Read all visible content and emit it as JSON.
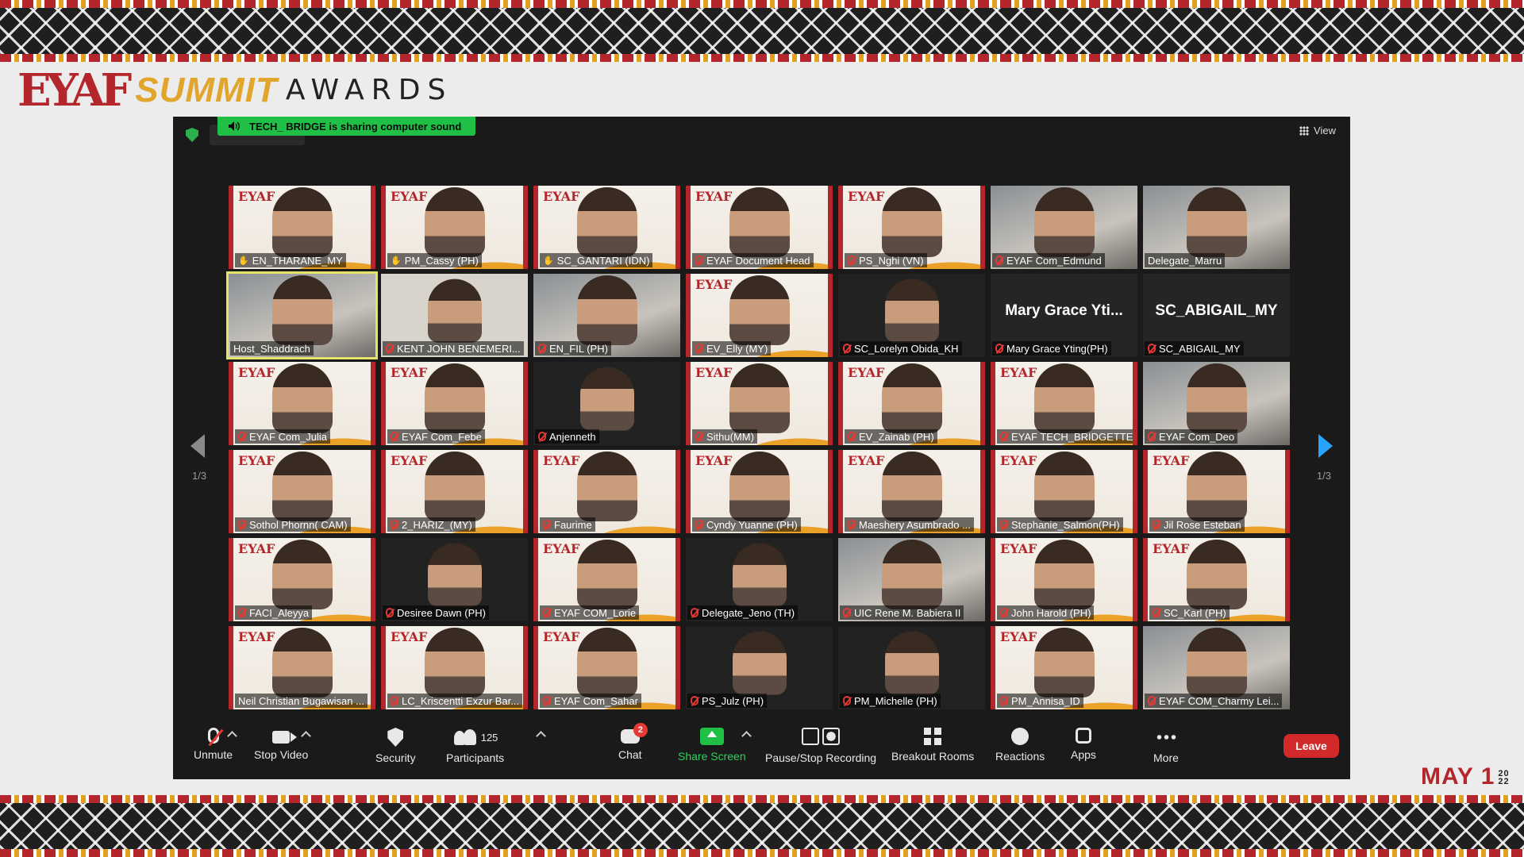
{
  "branding": {
    "logo_mark": "EYAF",
    "logo_summit": "SUMMIT",
    "logo_awards": "AWARDS",
    "date_main": "MAY 1",
    "date_year": "2022",
    "accent_color": "#b3262b",
    "gold_color": "#e2a52c"
  },
  "meeting": {
    "sharing_banner": "TECH_ BRIDGE is sharing computer sound",
    "view_label": "View",
    "page_indicator": "1/3"
  },
  "participants": [
    {
      "name": "EN_THARANE_MY",
      "bg": "banner",
      "mic": "raised"
    },
    {
      "name": "PM_Cassy (PH)",
      "bg": "banner",
      "mic": "raised"
    },
    {
      "name": "SC_GANTARI (IDN)",
      "bg": "banner",
      "mic": "raised"
    },
    {
      "name": "EYAF Document Head",
      "bg": "banner",
      "mic": "muted"
    },
    {
      "name": "PS_Nghi (VN)",
      "bg": "banner",
      "mic": "muted"
    },
    {
      "name": "EYAF Com_Edmund",
      "bg": "webcam",
      "mic": "muted"
    },
    {
      "name": "Delegate_Marru",
      "bg": "webcam",
      "mic": "none"
    },
    {
      "name": "Host_Shaddrach",
      "bg": "webcam",
      "mic": "none",
      "active": true
    },
    {
      "name": "KENT JOHN BENEMERI...",
      "bg": "plain",
      "mic": "muted"
    },
    {
      "name": "EN_FIL (PH)",
      "bg": "webcam",
      "mic": "muted"
    },
    {
      "name": "EV_Elly (MY)",
      "bg": "banner",
      "mic": "muted"
    },
    {
      "name": "SC_Lorelyn Obida_KH",
      "bg": "dark",
      "mic": "muted"
    },
    {
      "name": "Mary Grace Yting(PH)",
      "bg": "name",
      "mic": "muted",
      "big": "Mary Grace Yti..."
    },
    {
      "name": "SC_ABIGAIL_MY",
      "bg": "name",
      "mic": "muted",
      "big": "SC_ABIGAIL_MY"
    },
    {
      "name": "EYAF Com_Julia",
      "bg": "banner",
      "mic": "muted"
    },
    {
      "name": "EYAF Com_Febe",
      "bg": "banner",
      "mic": "muted"
    },
    {
      "name": "Anjenneth",
      "bg": "dark",
      "mic": "muted"
    },
    {
      "name": "Sithu(MM)",
      "bg": "banner",
      "mic": "muted"
    },
    {
      "name": "EV_Zainab (PH)",
      "bg": "banner",
      "mic": "muted"
    },
    {
      "name": "EYAF TECH_BRIDGETTE",
      "bg": "banner",
      "mic": "muted"
    },
    {
      "name": "EYAF Com_Deo",
      "bg": "webcam",
      "mic": "muted"
    },
    {
      "name": "Sothol Phornn( CAM)",
      "bg": "banner",
      "mic": "muted"
    },
    {
      "name": "2_HARIZ_(MY)",
      "bg": "banner",
      "mic": "muted"
    },
    {
      "name": "Faurime",
      "bg": "banner",
      "mic": "muted"
    },
    {
      "name": "Cyndy Yuanne (PH)",
      "bg": "banner",
      "mic": "muted"
    },
    {
      "name": "Maeshery Asumbrado ...",
      "bg": "banner",
      "mic": "muted"
    },
    {
      "name": "Stephanie_Salmon(PH)",
      "bg": "banner",
      "mic": "muted"
    },
    {
      "name": "Jil Rose Esteban",
      "bg": "banner",
      "mic": "muted"
    },
    {
      "name": "FACI_Aleyya",
      "bg": "banner",
      "mic": "muted"
    },
    {
      "name": "Desiree Dawn  (PH)",
      "bg": "dark",
      "mic": "muted"
    },
    {
      "name": "EYAF COM_Lorie",
      "bg": "banner",
      "mic": "muted"
    },
    {
      "name": "Delegate_Jeno (TH)",
      "bg": "dark",
      "mic": "muted"
    },
    {
      "name": "UIC Rene M. Babiera II",
      "bg": "webcam",
      "mic": "muted"
    },
    {
      "name": "John Harold (PH)",
      "bg": "banner",
      "mic": "muted"
    },
    {
      "name": "SC_Karl (PH)",
      "bg": "banner",
      "mic": "muted"
    },
    {
      "name": "Neil Christian Bugawisan ...",
      "bg": "banner",
      "mic": "none"
    },
    {
      "name": "LC_Kriscentti Exzur Bar...",
      "bg": "banner",
      "mic": "muted"
    },
    {
      "name": "EYAF Com_Sahar",
      "bg": "banner",
      "mic": "muted"
    },
    {
      "name": "PS_Julz (PH)",
      "bg": "dark",
      "mic": "muted"
    },
    {
      "name": "PM_Michelle (PH)",
      "bg": "dark",
      "mic": "muted"
    },
    {
      "name": "PM_Annisa_ID",
      "bg": "banner",
      "mic": "muted"
    },
    {
      "name": "EYAF COM_Charmy Lei...",
      "bg": "webcam",
      "mic": "muted"
    }
  ],
  "toolbar": {
    "unmute": "Unmute",
    "stop_video": "Stop Video",
    "security": "Security",
    "participants": "Participants",
    "participants_count": "125",
    "chat": "Chat",
    "chat_badge": "2",
    "share_screen": "Share Screen",
    "recording": "Pause/Stop Recording",
    "breakout": "Breakout Rooms",
    "reactions": "Reactions",
    "apps": "Apps",
    "more": "More",
    "leave": "Leave"
  }
}
